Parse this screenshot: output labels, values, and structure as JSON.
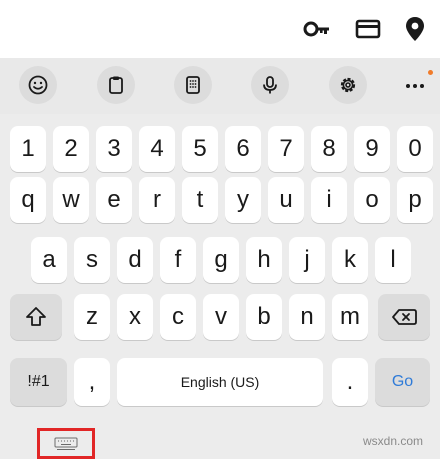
{
  "autofill": {
    "icons": [
      "key-icon",
      "credit-card-icon",
      "location-pin-icon"
    ]
  },
  "toolbar": {
    "buttons": [
      "emoji-icon",
      "clipboard-icon",
      "keypad-icon",
      "microphone-icon",
      "settings-icon",
      "more-icon"
    ]
  },
  "keyboard": {
    "row_numbers": [
      "1",
      "2",
      "3",
      "4",
      "5",
      "6",
      "7",
      "8",
      "9",
      "0"
    ],
    "row_1": [
      "q",
      "w",
      "e",
      "r",
      "t",
      "y",
      "u",
      "i",
      "o",
      "p"
    ],
    "row_2": [
      "a",
      "s",
      "d",
      "f",
      "g",
      "h",
      "j",
      "k",
      "l"
    ],
    "row_3": [
      "z",
      "x",
      "c",
      "v",
      "b",
      "n",
      "m"
    ],
    "symbols_label": "!#1",
    "comma_label": ",",
    "space_label": "English (US)",
    "period_label": ".",
    "go_label": "Go",
    "shift_icon": "shift-icon",
    "backspace_icon": "backspace-icon"
  },
  "bottom": {
    "keyboard_switch_icon": "keyboard-icon",
    "watermark": "wsxdn.com"
  },
  "colors": {
    "go_text": "#2f7bd8",
    "highlight_box": "#e12626",
    "notification_dot": "#f07b2a"
  }
}
